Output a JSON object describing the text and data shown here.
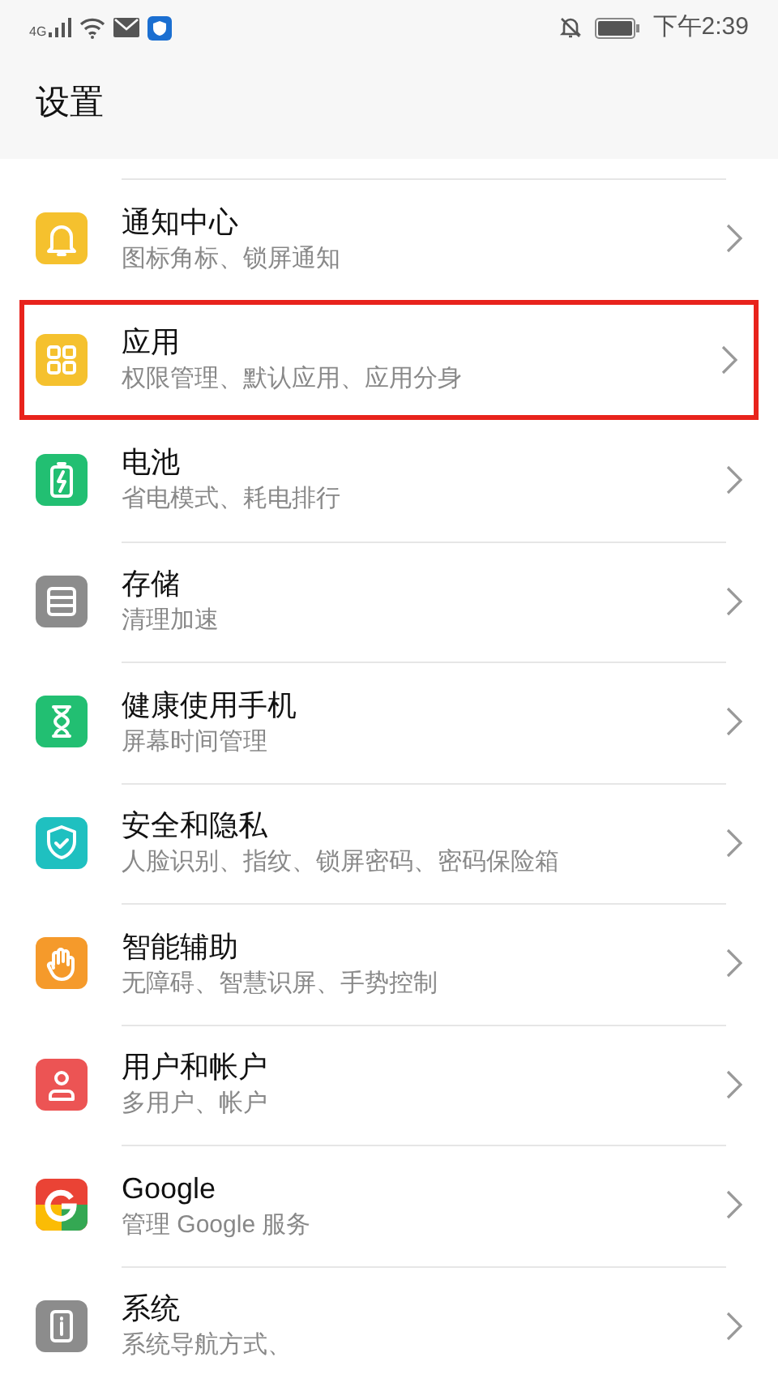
{
  "status_bar": {
    "network": "4G",
    "time": "下午2:39"
  },
  "title": "设置",
  "items": [
    {
      "kind": "bell",
      "color": "#f5c12e",
      "title": "通知中心",
      "subtitle": "图标角标、锁屏通知",
      "highlighted": false
    },
    {
      "kind": "grid",
      "color": "#f5c12e",
      "title": "应用",
      "subtitle": "权限管理、默认应用、应用分身",
      "highlighted": true
    },
    {
      "kind": "battery",
      "color": "#22bf72",
      "title": "电池",
      "subtitle": "省电模式、耗电排行",
      "highlighted": false
    },
    {
      "kind": "storage",
      "color": "#8c8c8c",
      "title": "存储",
      "subtitle": "清理加速",
      "highlighted": false
    },
    {
      "kind": "hourglass",
      "color": "#22bf72",
      "title": "健康使用手机",
      "subtitle": "屏幕时间管理",
      "highlighted": false
    },
    {
      "kind": "shield",
      "color": "#1fc0c0",
      "title": "安全和隐私",
      "subtitle": "人脸识别、指纹、锁屏密码、密码保险箱",
      "highlighted": false
    },
    {
      "kind": "hand",
      "color": "#f59a2b",
      "title": "智能辅助",
      "subtitle": "无障碍、智慧识屏、手势控制",
      "highlighted": false
    },
    {
      "kind": "user",
      "color": "#ec5454",
      "title": "用户和帐户",
      "subtitle": "多用户、帐户",
      "highlighted": false
    },
    {
      "kind": "google",
      "title": "Google",
      "subtitle": "管理 Google 服务",
      "highlighted": false
    },
    {
      "kind": "info",
      "color": "#8c8c8c",
      "title": "系统",
      "subtitle": "系统导航方式、",
      "highlighted": false
    }
  ]
}
